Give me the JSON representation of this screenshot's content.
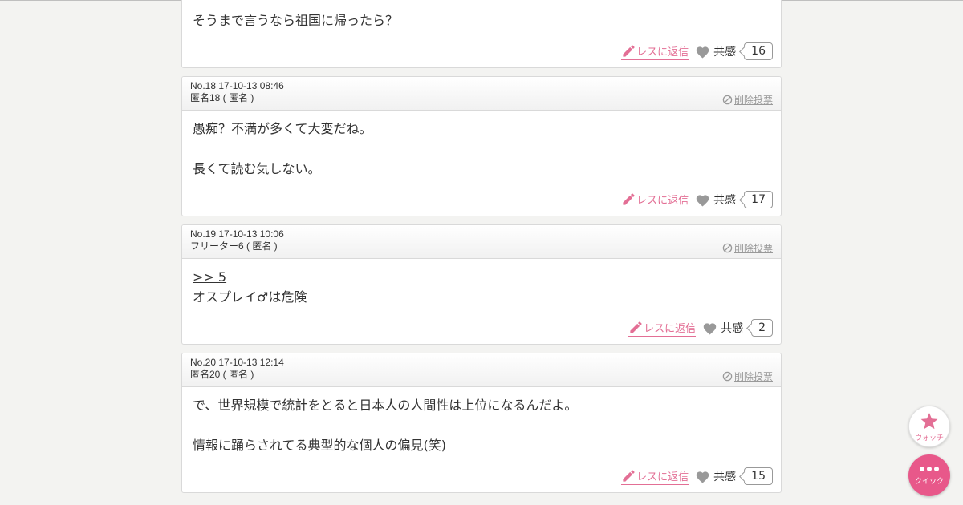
{
  "posts": [
    {
      "no": "",
      "author": "",
      "body": [
        "そうまで言うなら祖国に帰ったら？"
      ],
      "reply_label": "レスに返信",
      "like_label": "共感",
      "like_count": "16"
    },
    {
      "no": "No.18 17-10-13 08:46",
      "author": "匿名18 ( 匿名 )",
      "delete_label": "削除投票",
      "body": [
        "愚痴？不満が多くて大変だね。",
        "",
        "長くて読む気しない。"
      ],
      "reply_label": "レスに返信",
      "like_label": "共感",
      "like_count": "17"
    },
    {
      "no": "No.19 17-10-13 10:06",
      "author": "フリーター6 ( 匿名 )",
      "delete_label": "削除投票",
      "anchor": ">> 5",
      "body": [
        "オスプレイ♂は危険"
      ],
      "reply_label": "レスに返信",
      "like_label": "共感",
      "like_count": "2"
    },
    {
      "no": "No.20 17-10-13 12:14",
      "author": "匿名20 ( 匿名 )",
      "delete_label": "削除投票",
      "body": [
        "で、世界規模で統計をとると日本人の人間性は上位になるんだよ。",
        "",
        "情報に踊らされてる典型的な個人の偏見(笑)"
      ],
      "reply_label": "レスに返信",
      "like_label": "共感",
      "like_count": "15"
    }
  ],
  "fab": {
    "watch_label": "ウォッチ",
    "quick_label": "クイック"
  },
  "colors": {
    "accent": "#e36f95",
    "quick_bg": "#e8588a"
  }
}
